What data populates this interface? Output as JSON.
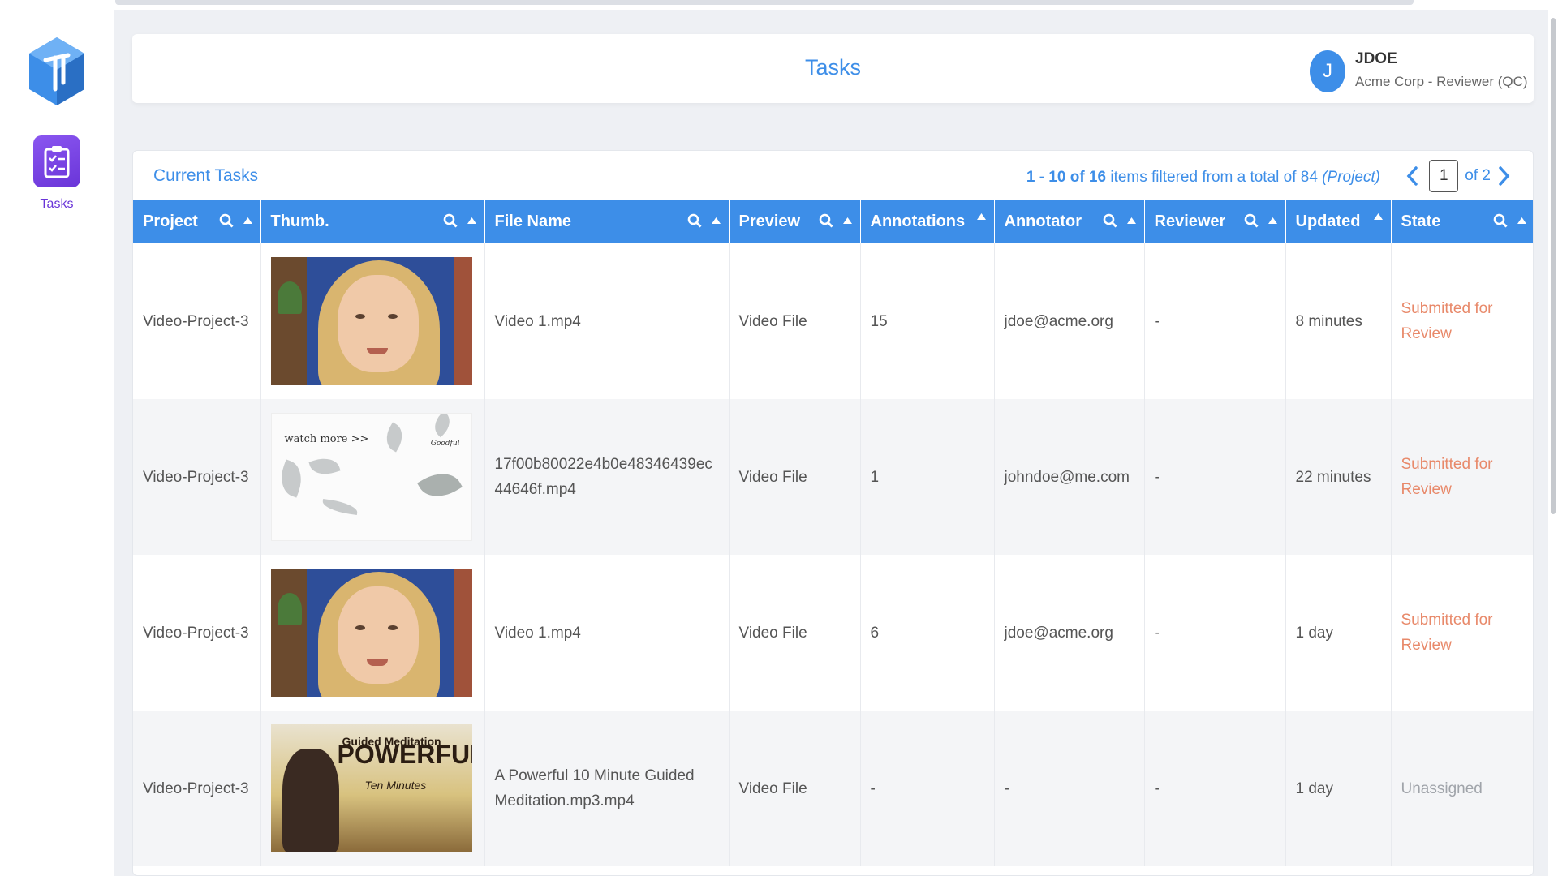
{
  "sidebar": {
    "nav": [
      {
        "label": "Tasks",
        "icon": "clipboard-check-icon",
        "active": true
      }
    ]
  },
  "header": {
    "title": "Tasks",
    "user": {
      "initial": "J",
      "name": "JDOE",
      "role": "Acme Corp - Reviewer (QC)"
    }
  },
  "tasks": {
    "section_title": "Current Tasks",
    "paging": {
      "range": "1 - 10 of 16",
      "text": " items filtered from a total of 84 ",
      "scope": "(Project)",
      "current_page": "1",
      "of_pages": "of 2"
    },
    "columns": [
      "Project",
      "Thumb.",
      "File Name",
      "Preview",
      "Annotations",
      "Annotator",
      "Reviewer",
      "Updated",
      "State"
    ],
    "rows": [
      {
        "project": "Video-Project-3",
        "thumb": "face",
        "file_name": "Video 1.mp4",
        "preview": "Video File",
        "annotations": "15",
        "annotator": "jdoe@acme.org",
        "reviewer": "-",
        "updated": "8 minutes",
        "state": "Submitted for Review"
      },
      {
        "project": "Video-Project-3",
        "thumb": "leaves",
        "file_name": "17f00b80022e4b0e48346439ec44646f.mp4",
        "preview": "Video File",
        "annotations": "1",
        "annotator": "johndoe@me.com",
        "reviewer": "-",
        "updated": "22 minutes",
        "state": "Submitted for Review"
      },
      {
        "project": "Video-Project-3",
        "thumb": "face",
        "file_name": "Video 1.mp4",
        "preview": "Video File",
        "annotations": "6",
        "annotator": "jdoe@acme.org",
        "reviewer": "-",
        "updated": "1 day",
        "state": "Submitted for Review"
      },
      {
        "project": "Video-Project-3",
        "thumb": "meditation",
        "file_name": "A Powerful 10 Minute Guided Meditation.mp3.mp4",
        "preview": "Video File",
        "annotations": "-",
        "annotator": "-",
        "reviewer": "-",
        "updated": "1 day",
        "state": "Unassigned"
      }
    ],
    "thumb_text": {
      "leaves_watch": "watch more >>",
      "leaves_brand": "Goodful",
      "med_line1": "Guided Meditation",
      "med_line2": "POWERFUL",
      "med_line3": "Ten Minutes"
    }
  },
  "colors": {
    "accent": "#3d8ee8",
    "nav_active": "#6a35d8",
    "submitted": "#e8896a",
    "unassigned": "#a0a4aa"
  }
}
